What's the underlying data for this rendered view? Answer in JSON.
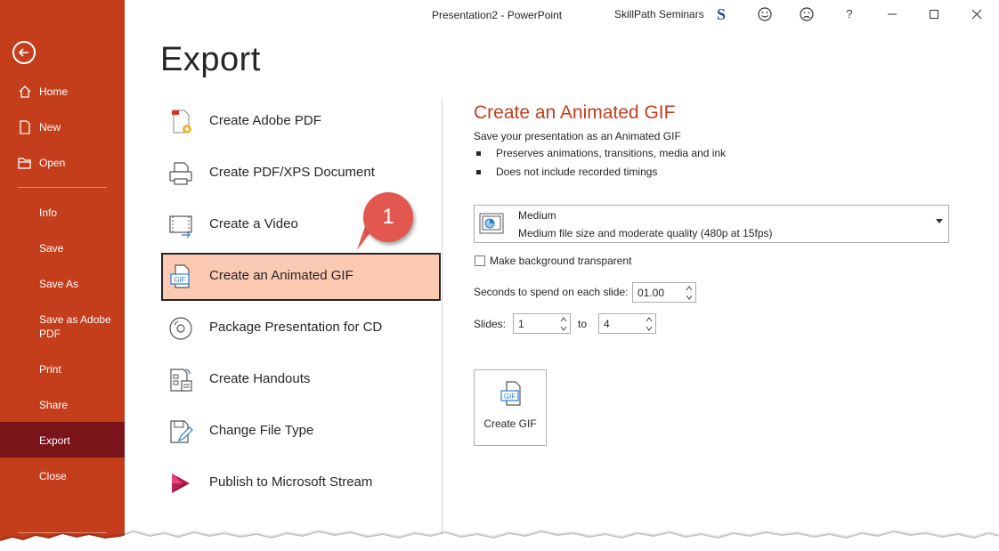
{
  "app": {
    "document_title": "Presentation2  -  PowerPoint",
    "user_name": "SkillPath Seminars",
    "user_avatar_letter": "S",
    "help_label": "?"
  },
  "sidebar": {
    "back_icon": "back-arrow-icon",
    "items": [
      {
        "label": "Home",
        "icon": "home-icon"
      },
      {
        "label": "New",
        "icon": "new-file-icon"
      },
      {
        "label": "Open",
        "icon": "open-folder-icon"
      },
      {
        "label": "Info"
      },
      {
        "label": "Save"
      },
      {
        "label": "Save As"
      },
      {
        "label": "Save as Adobe PDF"
      },
      {
        "label": "Print"
      },
      {
        "label": "Share"
      },
      {
        "label": "Export",
        "active": true
      },
      {
        "label": "Close"
      }
    ],
    "background": "#c43e1c",
    "active_background": "#7a1419"
  },
  "page": {
    "heading": "Export"
  },
  "export_options": [
    {
      "label": "Create Adobe PDF",
      "icon": "adobe-pdf-icon"
    },
    {
      "label": "Create PDF/XPS Document",
      "icon": "pdf-xps-icon"
    },
    {
      "label": "Create a Video",
      "icon": "video-icon"
    },
    {
      "label": "Create an Animated GIF",
      "icon": "gif-icon",
      "selected": true
    },
    {
      "label": "Package Presentation for CD",
      "icon": "cd-icon"
    },
    {
      "label": "Create Handouts",
      "icon": "handouts-icon"
    },
    {
      "label": "Change File Type",
      "icon": "change-file-type-icon"
    },
    {
      "label": "Publish to Microsoft Stream",
      "icon": "stream-icon"
    }
  ],
  "callout": {
    "number": "1",
    "color": "#e2574f"
  },
  "panel": {
    "title": "Create an Animated GIF",
    "description": "Save your presentation as an Animated GIF",
    "bullets": [
      "Preserves animations, transitions, media and ink",
      "Does not include recorded timings"
    ],
    "quality": {
      "name": "Medium",
      "description": "Medium file size and moderate quality (480p at 15fps)"
    },
    "transparent_label": "Make background transparent",
    "transparent_checked": false,
    "seconds_label": "Seconds to spend on each slide:",
    "seconds_value": "01.00",
    "slides_label": "Slides:",
    "slides_from": "1",
    "to_label": "to",
    "slides_to": "4",
    "create_button_label": "Create GIF",
    "accent_color": "#c43e1c"
  }
}
